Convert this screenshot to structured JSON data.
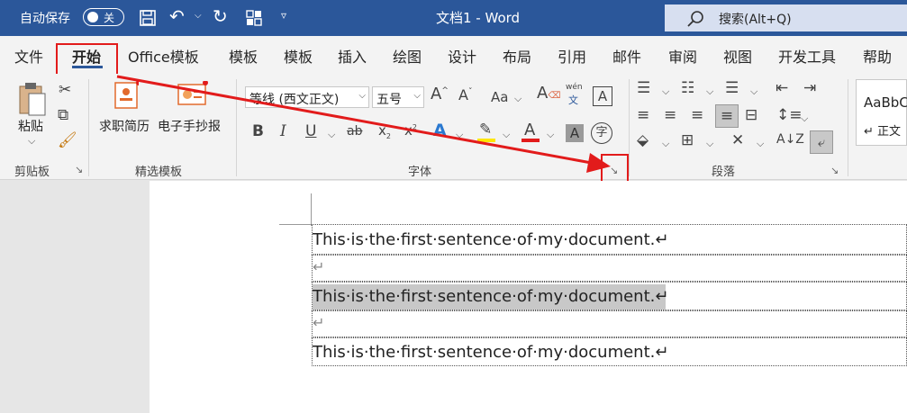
{
  "titlebar": {
    "autosave_label": "自动保存",
    "autosave_state": "关",
    "doc_title": "文档1  -  Word",
    "search_placeholder": "搜索(Alt+Q)"
  },
  "tabs": [
    "文件",
    "开始",
    "Office模板",
    "模板",
    "模板",
    "插入",
    "绘图",
    "设计",
    "布局",
    "引用",
    "邮件",
    "审阅",
    "视图",
    "开发工具",
    "帮助"
  ],
  "active_tab": "开始",
  "ribbon": {
    "clipboard": {
      "paste_label": "粘贴",
      "group_label": "剪贴板"
    },
    "templates": {
      "resume_label": "求职简历",
      "handout_label": "电子手抄报",
      "group_label": "精选模板"
    },
    "font": {
      "font_name": "等线 (西文正文)",
      "font_size": "五号",
      "group_label": "字体",
      "change_case": "Aa",
      "wen": "wén"
    },
    "paragraph": {
      "group_label": "段落"
    },
    "styles": {
      "preview": "AaBbC",
      "name": "↵ 正文"
    }
  },
  "document": {
    "lines": [
      "This·is·the·first·sentence·of·my·document.↵",
      "↵",
      "This·is·the·first·sentence·of·my·document.↵",
      "↵",
      "This·is·the·first·sentence·of·my·document.↵"
    ]
  },
  "colors": {
    "titlebar": "#2b579a",
    "highlight_box": "#e21b1b",
    "selection": "#c8c8c8"
  }
}
